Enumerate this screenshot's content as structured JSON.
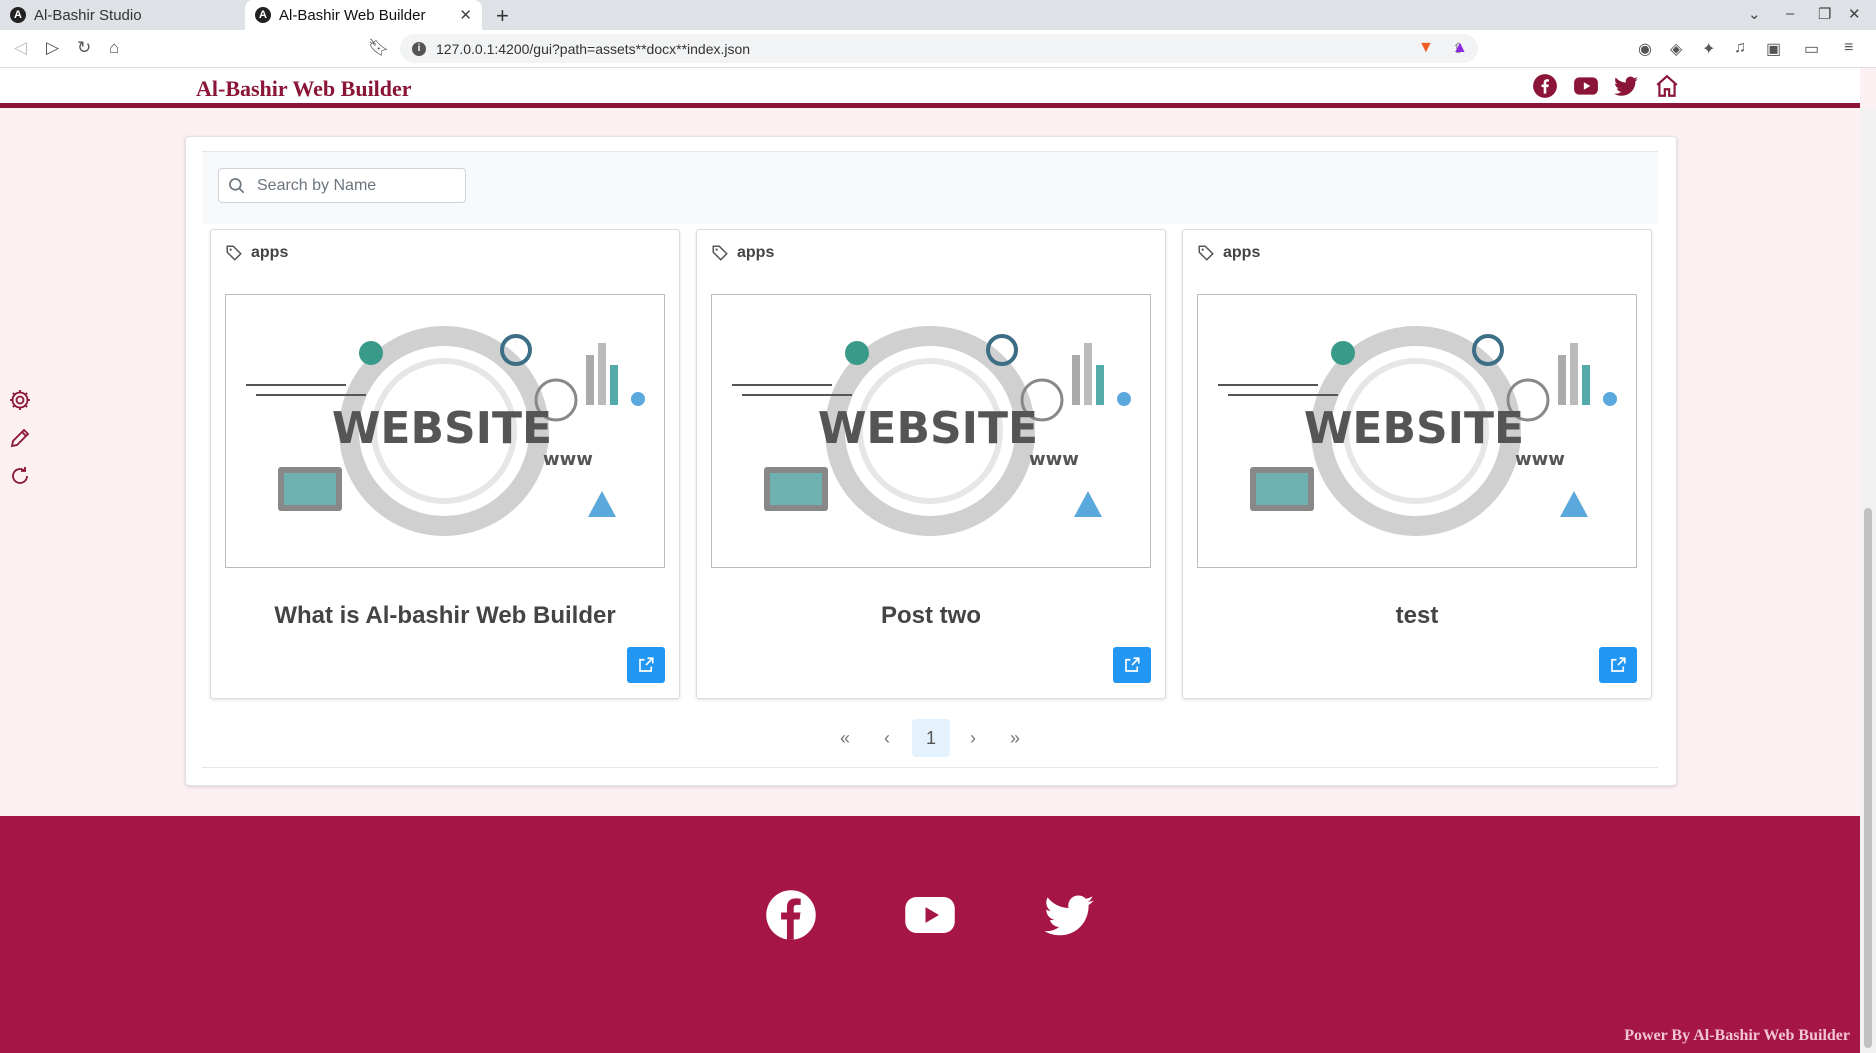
{
  "browser": {
    "tabs": [
      {
        "title": "Al-Bashir Studio",
        "active": false
      },
      {
        "title": "Al-Bashir Web Builder",
        "active": true
      }
    ],
    "url": "127.0.0.1:4200/gui?path=assets**docx**index.json"
  },
  "header": {
    "brand": "Al-Bashir Web Builder",
    "icons": [
      "facebook-icon",
      "youtube-icon",
      "twitter-icon",
      "home-icon"
    ]
  },
  "side_tools": [
    "gear-icon",
    "pencil-icon",
    "refresh-icon"
  ],
  "search": {
    "placeholder": "Search by Name",
    "value": ""
  },
  "cards": [
    {
      "tag": "apps",
      "title": "What is Al-bashir Web Builder",
      "image_text": "WEBSITE",
      "image_sub": "www"
    },
    {
      "tag": "apps",
      "title": "Post two",
      "image_text": "WEBSITE",
      "image_sub": "www"
    },
    {
      "tag": "apps",
      "title": "test",
      "image_text": "WEBSITE",
      "image_sub": "www"
    }
  ],
  "pagination": {
    "first": "«",
    "prev": "‹",
    "current": "1",
    "next": "›",
    "last": "»"
  },
  "footer": {
    "icons": [
      "facebook-icon",
      "youtube-icon",
      "twitter-icon"
    ],
    "power": "Power By Al-Bashir Web Builder"
  },
  "colors": {
    "brand": "#8a1538",
    "footer": "#a51545",
    "accent": "#2196f3"
  }
}
